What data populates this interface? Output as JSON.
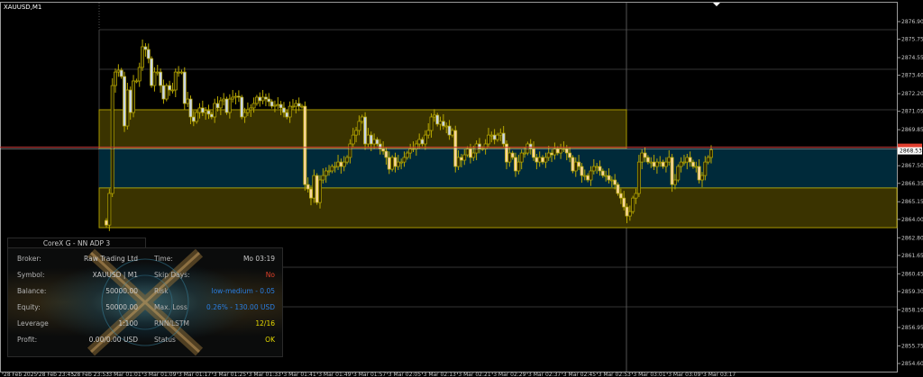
{
  "symbol_title": "XAUUSD,M1",
  "colors": {
    "background": "#000000",
    "bull_body": "#fff2a8",
    "bear_body": "#c8d4e8",
    "wick": "#b8a800",
    "zone_yellow": "#3a3300",
    "zone_blue": "#002a3a",
    "bid_line": "#d04040",
    "current_price_bg": "#ffffff"
  },
  "chart_data": {
    "type": "candlestick",
    "symbol": "XAUUSD",
    "timeframe": "M1",
    "ylim": [
      2854.6,
      2876.9
    ],
    "price_ticks": [
      "2876.90",
      "2875.75",
      "2874.55",
      "2873.40",
      "2872.20",
      "2871.05",
      "2869.85",
      "2867.50",
      "2866.35",
      "2865.15",
      "2864.00",
      "2862.80",
      "2861.65",
      "2860.45",
      "2859.30",
      "2858.10",
      "2856.95",
      "2855.75",
      "2854.60"
    ],
    "current_price": "2868.53",
    "time_ticks": [
      "28 Feb 2025",
      "28 Feb 23:45",
      "28 Feb 23:53",
      "3 Mar 01:01",
      "3 Mar 01:09",
      "3 Mar 01:17",
      "3 Mar 01:25",
      "3 Mar 01:33",
      "3 Mar 01:41",
      "3 Mar 01:49",
      "3 Mar 01:57",
      "3 Mar 02:05",
      "3 Mar 02:13",
      "3 Mar 02:21",
      "3 Mar 02:29",
      "3 Mar 02:37",
      "3 Mar 02:45",
      "3 Mar 02:53",
      "3 Mar 03:01",
      "3 Mar 03:09",
      "3 Mar 03:17"
    ],
    "zones": [
      {
        "type": "supply",
        "from": 2868.62,
        "to": 2871.15,
        "color": "#3a3300"
      },
      {
        "type": "mid",
        "from": 2866.05,
        "to": 2868.62,
        "color": "#002a3a"
      },
      {
        "type": "demand",
        "from": 2863.46,
        "to": 2866.05,
        "color": "#3a3300"
      }
    ],
    "closes": [
      2863.63,
      2865.69,
      2872.73,
      2873.61,
      2873.73,
      2873.32,
      2870.09,
      2872.44,
      2870.97,
      2873.03,
      2873.03,
      2873.91,
      2875.26,
      2875.08,
      2874.49,
      2872.73,
      2873.61,
      2873.61,
      2872.73,
      2871.85,
      2872.73,
      2872.44,
      2872.44,
      2873.61,
      2873.61,
      2873.61,
      2871.56,
      2871.85,
      2870.68,
      2870.39,
      2870.97,
      2871.27,
      2870.97,
      2871.09,
      2870.86,
      2870.68,
      2871.56,
      2871.27,
      2871.74,
      2871.85,
      2870.97,
      2871.85,
      2871.97,
      2872.03,
      2871.97,
      2870.68,
      2870.97,
      2871.15,
      2871.27,
      2871.56,
      2871.97,
      2871.74,
      2871.97,
      2871.85,
      2871.68,
      2871.38,
      2871.44,
      2871.5,
      2871.27,
      2870.97,
      2870.68,
      2871.38,
      2871.38,
      2871.56,
      2871.38,
      2871.38,
      2866.27,
      2865.98,
      2865.39,
      2866.86,
      2865.1,
      2866.57,
      2866.86,
      2867.16,
      2867.16,
      2867.45,
      2867.45,
      2867.74,
      2867.45,
      2867.74,
      2868.04,
      2868.92,
      2869.5,
      2869.8,
      2870.39,
      2870.68,
      2868.92,
      2869.5,
      2868.92,
      2869.21,
      2868.92,
      2868.62,
      2868.45,
      2868.04,
      2867.27,
      2868.04,
      2867.45,
      2867.74,
      2867.74,
      2868.04,
      2868.33,
      2868.62,
      2868.62,
      2868.92,
      2869.21,
      2868.92,
      2869.5,
      2869.8,
      2870.68,
      2870.8,
      2870.21,
      2870.39,
      2870.09,
      2870.09,
      2869.5,
      2869.8,
      2867.45,
      2868.04,
      2867.86,
      2868.21,
      2868.62,
      2868.04,
      2868.33,
      2868.92,
      2868.62,
      2868.62,
      2868.92,
      2869.5,
      2869.5,
      2869.21,
      2869.5,
      2869.62,
      2868.92,
      2867.74,
      2868.33,
      2868.04,
      2867.16,
      2867.74,
      2868.33,
      2868.33,
      2868.92,
      2868.62,
      2868.04,
      2867.74,
      2868.04,
      2867.74,
      2868.04,
      2868.33,
      2868.21,
      2868.62,
      2868.33,
      2868.62,
      2868.62,
      2868.33,
      2868.04,
      2867.16,
      2867.74,
      2867.45,
      2866.86,
      2866.86,
      2866.57,
      2867.16,
      2867.45,
      2867.45,
      2867.16,
      2866.86,
      2866.86,
      2866.57,
      2866.57,
      2866.27,
      2865.69,
      2865.39,
      2864.81,
      2864.22,
      2864.51,
      2865.39,
      2865.69,
      2867.74,
      2868.33,
      2868.04,
      2867.74,
      2867.74,
      2867.45,
      2867.74,
      2867.74,
      2867.45,
      2867.74,
      2868.04,
      2866.27,
      2866.57,
      2867.45,
      2867.74,
      2867.74,
      2868.04,
      2867.74,
      2867.45,
      2867.45,
      2866.57,
      2866.86,
      2867.74,
      2868.04,
      2868.53
    ],
    "grid": false
  },
  "panel": {
    "title": "CoreX G  -  NN ADP 3",
    "rows": [
      {
        "label": "Broker:",
        "value": "Raw Trading Ltd",
        "label2": "Time:",
        "value2": "Mo 03:19",
        "value2_color": "#c8c8c8"
      },
      {
        "label": "Symbol:",
        "value": "XAUUSD | M1",
        "label2": "Skip Days:",
        "value2": "No",
        "value2_color": "#e0402a"
      },
      {
        "label": "Balance:",
        "value": "50000.00",
        "label2": "Risk",
        "value2": "low-medium - 0.05",
        "value2_color": "#2a7ee0"
      },
      {
        "label": "Equity:",
        "value": "50000.00",
        "label2": "Max. Loss",
        "value2": "0.26% - 130.00 USD",
        "value2_color": "#2a7ee0"
      },
      {
        "label": "Leverage",
        "value": "1:100",
        "label2": "RNN/LSTM",
        "value2": "12/16",
        "value2_color": "#e8dc00"
      },
      {
        "label": "Profit:",
        "value": "0.00/0.00 USD",
        "label2": "Status",
        "value2": "OK",
        "value2_color": "#e8dc00"
      }
    ]
  }
}
